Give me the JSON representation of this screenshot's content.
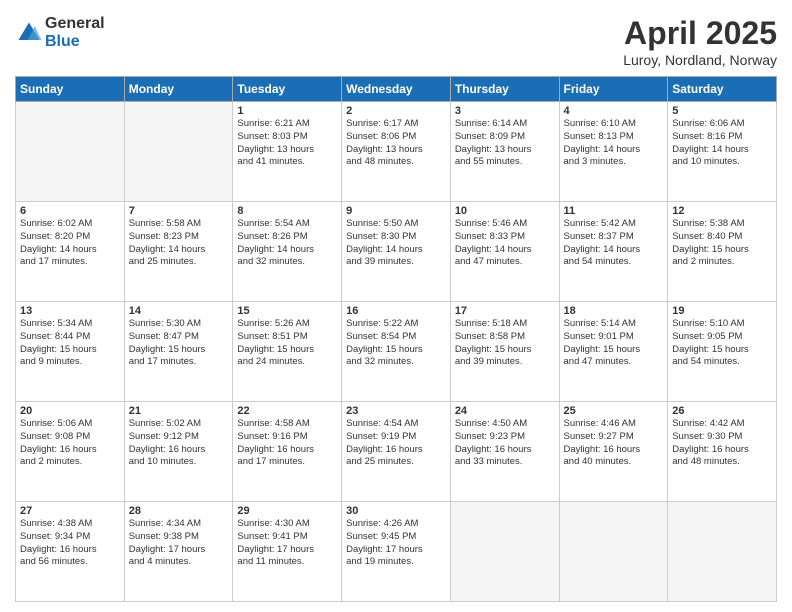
{
  "header": {
    "logo_general": "General",
    "logo_blue": "Blue",
    "title": "April 2025",
    "location": "Luroy, Nordland, Norway"
  },
  "weekdays": [
    "Sunday",
    "Monday",
    "Tuesday",
    "Wednesday",
    "Thursday",
    "Friday",
    "Saturday"
  ],
  "weeks": [
    [
      {
        "day": "",
        "info": ""
      },
      {
        "day": "",
        "info": ""
      },
      {
        "day": "1",
        "info": "Sunrise: 6:21 AM\nSunset: 8:03 PM\nDaylight: 13 hours\nand 41 minutes."
      },
      {
        "day": "2",
        "info": "Sunrise: 6:17 AM\nSunset: 8:06 PM\nDaylight: 13 hours\nand 48 minutes."
      },
      {
        "day": "3",
        "info": "Sunrise: 6:14 AM\nSunset: 8:09 PM\nDaylight: 13 hours\nand 55 minutes."
      },
      {
        "day": "4",
        "info": "Sunrise: 6:10 AM\nSunset: 8:13 PM\nDaylight: 14 hours\nand 3 minutes."
      },
      {
        "day": "5",
        "info": "Sunrise: 6:06 AM\nSunset: 8:16 PM\nDaylight: 14 hours\nand 10 minutes."
      }
    ],
    [
      {
        "day": "6",
        "info": "Sunrise: 6:02 AM\nSunset: 8:20 PM\nDaylight: 14 hours\nand 17 minutes."
      },
      {
        "day": "7",
        "info": "Sunrise: 5:58 AM\nSunset: 8:23 PM\nDaylight: 14 hours\nand 25 minutes."
      },
      {
        "day": "8",
        "info": "Sunrise: 5:54 AM\nSunset: 8:26 PM\nDaylight: 14 hours\nand 32 minutes."
      },
      {
        "day": "9",
        "info": "Sunrise: 5:50 AM\nSunset: 8:30 PM\nDaylight: 14 hours\nand 39 minutes."
      },
      {
        "day": "10",
        "info": "Sunrise: 5:46 AM\nSunset: 8:33 PM\nDaylight: 14 hours\nand 47 minutes."
      },
      {
        "day": "11",
        "info": "Sunrise: 5:42 AM\nSunset: 8:37 PM\nDaylight: 14 hours\nand 54 minutes."
      },
      {
        "day": "12",
        "info": "Sunrise: 5:38 AM\nSunset: 8:40 PM\nDaylight: 15 hours\nand 2 minutes."
      }
    ],
    [
      {
        "day": "13",
        "info": "Sunrise: 5:34 AM\nSunset: 8:44 PM\nDaylight: 15 hours\nand 9 minutes."
      },
      {
        "day": "14",
        "info": "Sunrise: 5:30 AM\nSunset: 8:47 PM\nDaylight: 15 hours\nand 17 minutes."
      },
      {
        "day": "15",
        "info": "Sunrise: 5:26 AM\nSunset: 8:51 PM\nDaylight: 15 hours\nand 24 minutes."
      },
      {
        "day": "16",
        "info": "Sunrise: 5:22 AM\nSunset: 8:54 PM\nDaylight: 15 hours\nand 32 minutes."
      },
      {
        "day": "17",
        "info": "Sunrise: 5:18 AM\nSunset: 8:58 PM\nDaylight: 15 hours\nand 39 minutes."
      },
      {
        "day": "18",
        "info": "Sunrise: 5:14 AM\nSunset: 9:01 PM\nDaylight: 15 hours\nand 47 minutes."
      },
      {
        "day": "19",
        "info": "Sunrise: 5:10 AM\nSunset: 9:05 PM\nDaylight: 15 hours\nand 54 minutes."
      }
    ],
    [
      {
        "day": "20",
        "info": "Sunrise: 5:06 AM\nSunset: 9:08 PM\nDaylight: 16 hours\nand 2 minutes."
      },
      {
        "day": "21",
        "info": "Sunrise: 5:02 AM\nSunset: 9:12 PM\nDaylight: 16 hours\nand 10 minutes."
      },
      {
        "day": "22",
        "info": "Sunrise: 4:58 AM\nSunset: 9:16 PM\nDaylight: 16 hours\nand 17 minutes."
      },
      {
        "day": "23",
        "info": "Sunrise: 4:54 AM\nSunset: 9:19 PM\nDaylight: 16 hours\nand 25 minutes."
      },
      {
        "day": "24",
        "info": "Sunrise: 4:50 AM\nSunset: 9:23 PM\nDaylight: 16 hours\nand 33 minutes."
      },
      {
        "day": "25",
        "info": "Sunrise: 4:46 AM\nSunset: 9:27 PM\nDaylight: 16 hours\nand 40 minutes."
      },
      {
        "day": "26",
        "info": "Sunrise: 4:42 AM\nSunset: 9:30 PM\nDaylight: 16 hours\nand 48 minutes."
      }
    ],
    [
      {
        "day": "27",
        "info": "Sunrise: 4:38 AM\nSunset: 9:34 PM\nDaylight: 16 hours\nand 56 minutes."
      },
      {
        "day": "28",
        "info": "Sunrise: 4:34 AM\nSunset: 9:38 PM\nDaylight: 17 hours\nand 4 minutes."
      },
      {
        "day": "29",
        "info": "Sunrise: 4:30 AM\nSunset: 9:41 PM\nDaylight: 17 hours\nand 11 minutes."
      },
      {
        "day": "30",
        "info": "Sunrise: 4:26 AM\nSunset: 9:45 PM\nDaylight: 17 hours\nand 19 minutes."
      },
      {
        "day": "",
        "info": ""
      },
      {
        "day": "",
        "info": ""
      },
      {
        "day": "",
        "info": ""
      }
    ]
  ]
}
